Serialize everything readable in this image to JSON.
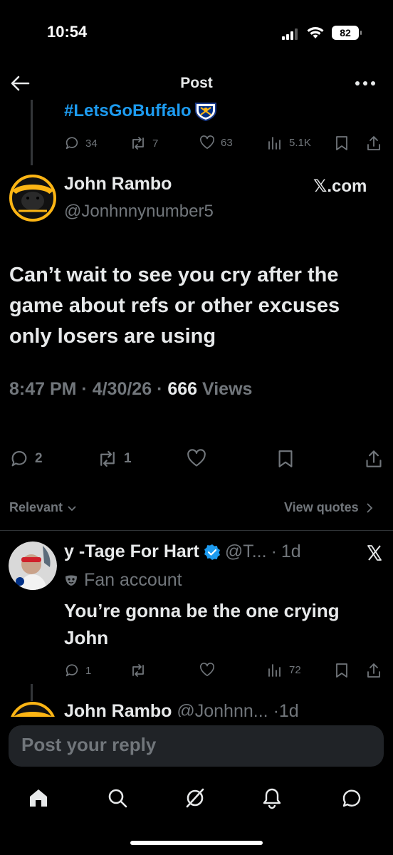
{
  "status_bar": {
    "time": "10:54",
    "battery": "82"
  },
  "nav": {
    "title": "Post"
  },
  "parent_tweet": {
    "hashtag": "#LetsGoBuffalo",
    "stats": {
      "replies": "34",
      "reposts": "7",
      "likes": "63",
      "views": "5.1K"
    }
  },
  "main_tweet": {
    "author_name": "John Rambo",
    "author_handle": "@Jonhnnynumber5",
    "source_label": "𝕏.com",
    "text": "Can’t wait to see you cry after the game about refs or other excuses only losers are using",
    "time": "8:47 PM",
    "date": "4/30/26",
    "views_count": "666",
    "views_label": "Views",
    "stats": {
      "replies": "2",
      "reposts": "1"
    }
  },
  "replies_header": {
    "sort_label": "Relevant",
    "view_quotes": "View quotes"
  },
  "reply": {
    "author_name": "y -Tage For Hart",
    "author_handle": "@T...",
    "age": "1d",
    "label": "Fan account",
    "text": "You’re gonna be the one crying John",
    "stats": {
      "replies": "1",
      "views": "72"
    }
  },
  "next_reply_peek": {
    "author_name": "John Rambo",
    "author_handle": "@Jonhnn...",
    "age": "1d"
  },
  "composer": {
    "placeholder": "Post your reply"
  },
  "colors": {
    "accent": "#1d9bf0",
    "background": "#000000",
    "muted": "#71767b",
    "verified": "#1d9bf0"
  },
  "icons": [
    "back-arrow-icon",
    "more-icon",
    "reply-icon",
    "repost-icon",
    "like-icon",
    "views-icon",
    "bookmark-icon",
    "share-icon",
    "home-icon",
    "search-icon",
    "grok-icon",
    "bell-icon",
    "messages-icon",
    "verified-icon",
    "x-logo-icon",
    "mask-icon"
  ]
}
